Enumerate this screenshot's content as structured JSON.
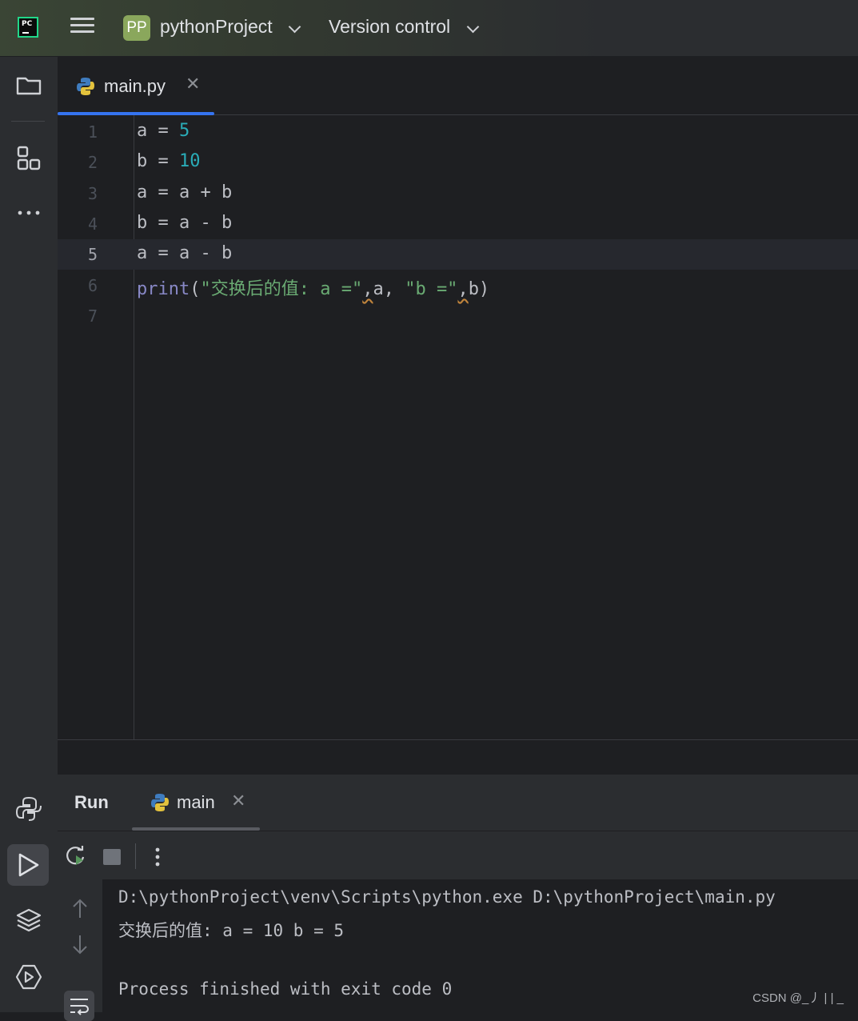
{
  "titlebar": {
    "project_badge": "PP",
    "project_name": "pythonProject",
    "version_control": "Version control"
  },
  "editor": {
    "tab_label": "main.py",
    "lines": [
      {
        "no": "1",
        "code": "a = 5"
      },
      {
        "no": "2",
        "code": "b = 10"
      },
      {
        "no": "3",
        "code": "a = a + b"
      },
      {
        "no": "4",
        "code": "b = a - b"
      },
      {
        "no": "5",
        "code": "a = a - b"
      },
      {
        "no": "6",
        "code": "print(\"交换后的值: a =\",a, \"b =\",b)"
      },
      {
        "no": "7",
        "code": ""
      }
    ],
    "current_line": "5"
  },
  "run": {
    "title": "Run",
    "tab_label": "main",
    "console": [
      "D:\\pythonProject\\venv\\Scripts\\python.exe D:\\pythonProject\\main.py",
      "交换后的值: a = 10 b = 5",
      "",
      "Process finished with exit code 0"
    ]
  },
  "watermark": "CSDN @_丿 | | _",
  "icons": {
    "project": "folder-icon",
    "structure": "structure-icon",
    "more": "more-icon",
    "python_console": "python-console-icon",
    "run": "run-icon",
    "layers": "layers-icon",
    "services": "services-icon"
  },
  "colors": {
    "accent": "#3574f0",
    "number": "#2aacb8",
    "string": "#6aab73",
    "builtin": "#8888c6"
  }
}
